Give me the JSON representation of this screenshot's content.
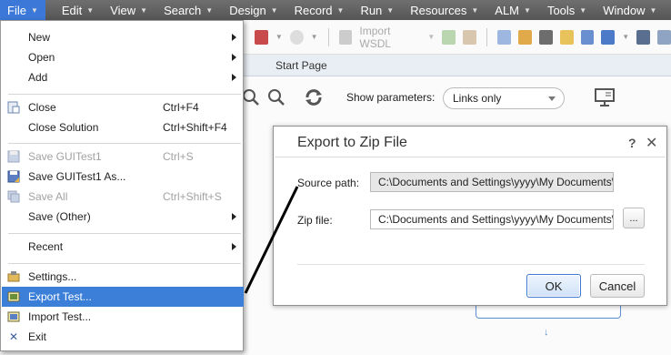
{
  "menubar": {
    "items": [
      {
        "label": "File"
      },
      {
        "label": "Edit"
      },
      {
        "label": "View"
      },
      {
        "label": "Search"
      },
      {
        "label": "Design"
      },
      {
        "label": "Record"
      },
      {
        "label": "Run"
      },
      {
        "label": "Resources"
      },
      {
        "label": "ALM"
      },
      {
        "label": "Tools"
      },
      {
        "label": "Window"
      }
    ]
  },
  "toolbar": {
    "import_wsdl_label": "Import WSDL"
  },
  "tabs": {
    "start_page": "Start Page"
  },
  "content": {
    "show_parameters_label": "Show parameters:",
    "show_parameters_value": "Links only"
  },
  "file_menu": {
    "new": "New",
    "open": "Open",
    "add": "Add",
    "close": "Close",
    "close_shortcut": "Ctrl+F4",
    "close_solution": "Close Solution",
    "close_solution_shortcut": "Ctrl+Shift+F4",
    "save_test": "Save GUITest1",
    "save_test_shortcut": "Ctrl+S",
    "save_test_as": "Save GUITest1  As...",
    "save_all": "Save All",
    "save_all_shortcut": "Ctrl+Shift+S",
    "save_other": "Save (Other)",
    "recent": "Recent",
    "settings": "Settings...",
    "export_test": "Export Test...",
    "import_test": "Import Test...",
    "exit": "Exit"
  },
  "dialog": {
    "title": "Export to Zip File",
    "help": "?",
    "close": "✕",
    "source_path_label": "Source path:",
    "source_path_value": "C:\\Documents and Settings\\yyyy\\My Documents\\",
    "zip_file_label": "Zip file:",
    "zip_file_value": "C:\\Documents and Settings\\yyyy\\My Documents\\",
    "browse_label": "...",
    "ok_label": "OK",
    "cancel_label": "Cancel"
  },
  "colors": {
    "menubar": "#5e5e5e",
    "highlight": "#3b7fd9",
    "disabled_text": "#a2a2a2"
  }
}
